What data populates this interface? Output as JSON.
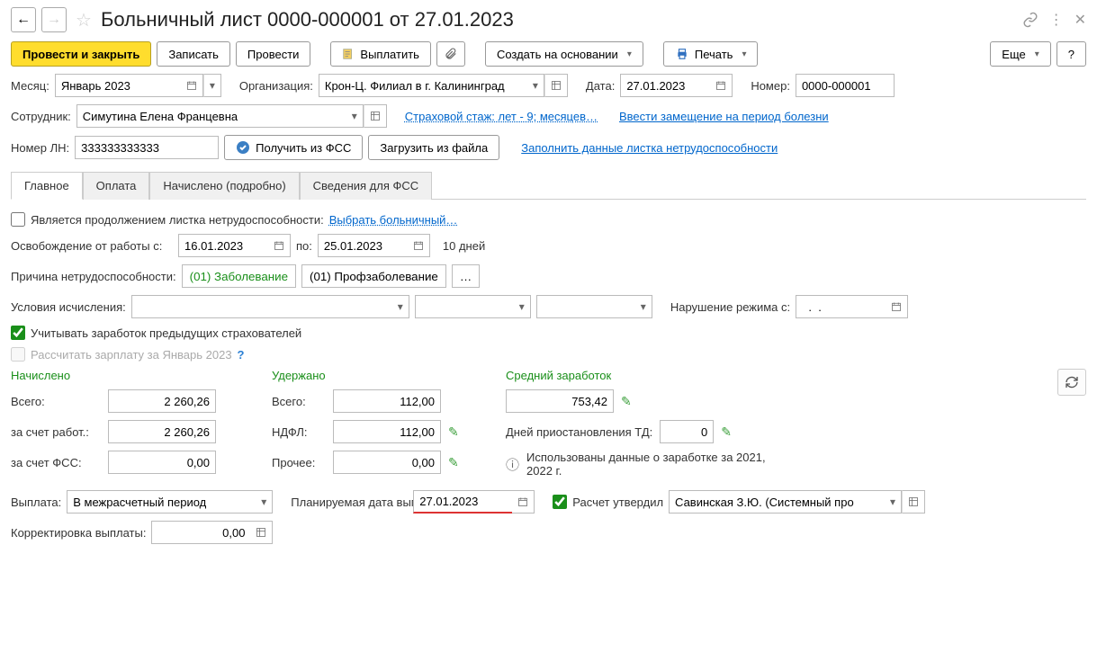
{
  "header": {
    "title": "Больничный лист 0000-000001 от 27.01.2023"
  },
  "toolbar": {
    "post_and_close": "Провести и закрыть",
    "save": "Записать",
    "post": "Провести",
    "pay": "Выплатить",
    "create_based_on": "Создать на основании",
    "print": "Печать",
    "more": "Еще",
    "help": "?"
  },
  "fields": {
    "month_label": "Месяц:",
    "month_value": "Январь 2023",
    "org_label": "Организация:",
    "org_value": "Крон-Ц. Филиал в г. Калининград",
    "date_label": "Дата:",
    "date_value": "27.01.2023",
    "number_label": "Номер:",
    "number_value": "0000-000001",
    "employee_label": "Сотрудник:",
    "employee_value": "Симутина Елена Францевна",
    "insurance_link": "Страховой стаж: лет - 9; месяцев…",
    "substitution_link": "Ввести замещение на период болезни",
    "ln_number_label": "Номер ЛН:",
    "ln_number_value": "333333333333",
    "get_from_fss": "Получить из ФСС",
    "load_from_file": "Загрузить из файла",
    "fill_data_link": "Заполнить данные листка нетрудоспособности"
  },
  "tabs": {
    "main": "Главное",
    "payment": "Оплата",
    "accrued": "Начислено (подробно)",
    "fss_info": "Сведения для ФСС"
  },
  "main_tab": {
    "continuation_label": "Является продолжением листка нетрудоспособности:",
    "select_sick_link": "Выбрать больничный…",
    "release_from_label": "Освобождение от работы с:",
    "release_from_value": "16.01.2023",
    "release_to_label": "по:",
    "release_to_value": "25.01.2023",
    "days_text": "10 дней",
    "cause_label": "Причина нетрудоспособности:",
    "cause_value": "(01) Заболевание",
    "cause2_value": "(01) Профзаболевание",
    "calc_conditions_label": "Условия исчисления:",
    "violation_label": "Нарушение режима с:",
    "violation_value": "  .  .    ",
    "consider_prev_label": "Учитывать заработок предыдущих страхователей",
    "recalc_salary_label": "Рассчитать зарплату за Январь 2023",
    "accrued_header": "Начислено",
    "held_header": "Удержано",
    "avg_header": "Средний заработок",
    "total_label": "Всего:",
    "accrued_total": "2 260,26",
    "held_total": "112,00",
    "avg_value": "753,42",
    "employer_label": "за счет работ.:",
    "employer_value": "2 260,26",
    "ndfl_label": "НДФЛ:",
    "ndfl_value": "112,00",
    "suspension_label": "Дней приостановления ТД:",
    "suspension_value": "0",
    "fss_label": "за счет ФСС:",
    "fss_value": "0,00",
    "other_label": "Прочее:",
    "other_value": "0,00",
    "data_used_text": "Использованы данные о заработке за  2021,   2022 г.",
    "payout_label": "Выплата:",
    "payout_value": "В межрасчетный период",
    "planned_date_label": "Планируемая дата выплаты:",
    "planned_date_value": "27.01.2023",
    "approved_label": "Расчет утвердил",
    "approver_value": "Савинская З.Ю. (Системный про",
    "correction_label": "Корректировка выплаты:",
    "correction_value": "0,00"
  }
}
